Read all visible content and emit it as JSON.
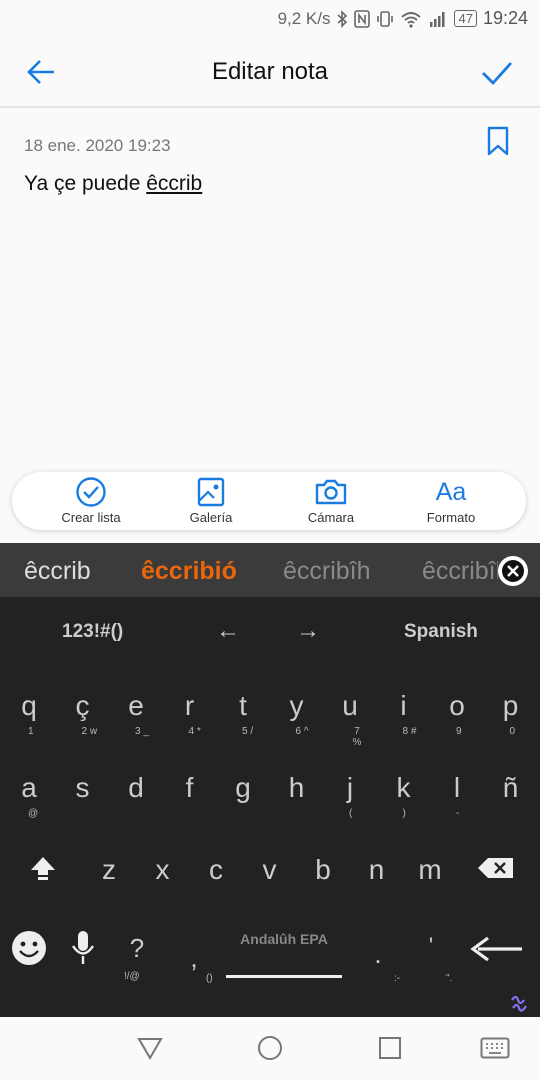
{
  "status": {
    "speed": "9,2 K/s",
    "battery": "47",
    "time": "19:24"
  },
  "appbar": {
    "title": "Editar nota"
  },
  "note": {
    "date": "18 ene. 2020 19:23",
    "text_plain": "Ya çe puede ",
    "text_underlined": "êccrib"
  },
  "toolbar": {
    "items": [
      {
        "label": "Crear lista",
        "icon": "check-circle-icon"
      },
      {
        "label": "Galería",
        "icon": "image-icon"
      },
      {
        "label": "Cámara",
        "icon": "camera-icon"
      },
      {
        "label": "Formato",
        "icon": "text-format-icon",
        "glyph": "Aa"
      }
    ]
  },
  "keyboard": {
    "suggestions": [
      "êccrib",
      "êccribió",
      "êccribîh",
      "êccribîh"
    ],
    "nav": {
      "numbers": "123!#()",
      "left": "←",
      "right": "→",
      "language": "Spanish"
    },
    "row1": [
      {
        "m": "q",
        "s": "1"
      },
      {
        "m": "ç",
        "s": "2 w"
      },
      {
        "m": "e",
        "s": "3 _"
      },
      {
        "m": "r",
        "s": "4 *"
      },
      {
        "m": "t",
        "s": "5 /"
      },
      {
        "m": "y",
        "s": "6 ^"
      },
      {
        "m": "u",
        "s": "7 %"
      },
      {
        "m": "i",
        "s": "8 #"
      },
      {
        "m": "o",
        "s": "9"
      },
      {
        "m": "p",
        "s": "0"
      }
    ],
    "row2": [
      {
        "m": "a",
        "s": "@"
      },
      {
        "m": "s",
        "s": ""
      },
      {
        "m": "d",
        "s": ""
      },
      {
        "m": "f",
        "s": ""
      },
      {
        "m": "g",
        "s": ""
      },
      {
        "m": "h",
        "s": ""
      },
      {
        "m": "j",
        "s": "("
      },
      {
        "m": "k",
        "s": ")"
      },
      {
        "m": "l",
        "s": "-"
      },
      {
        "m": "ñ",
        "s": ""
      }
    ],
    "row3": [
      "z",
      "x",
      "c",
      "v",
      "b",
      "n",
      "m"
    ],
    "question": "?",
    "question_sub": "!/@",
    "comma": ",",
    "comma_sub": "()",
    "space_label": "Andalûh EPA",
    "period": ".",
    "period_sub": ":-",
    "quote": "'",
    "quote_sub": "\"."
  }
}
